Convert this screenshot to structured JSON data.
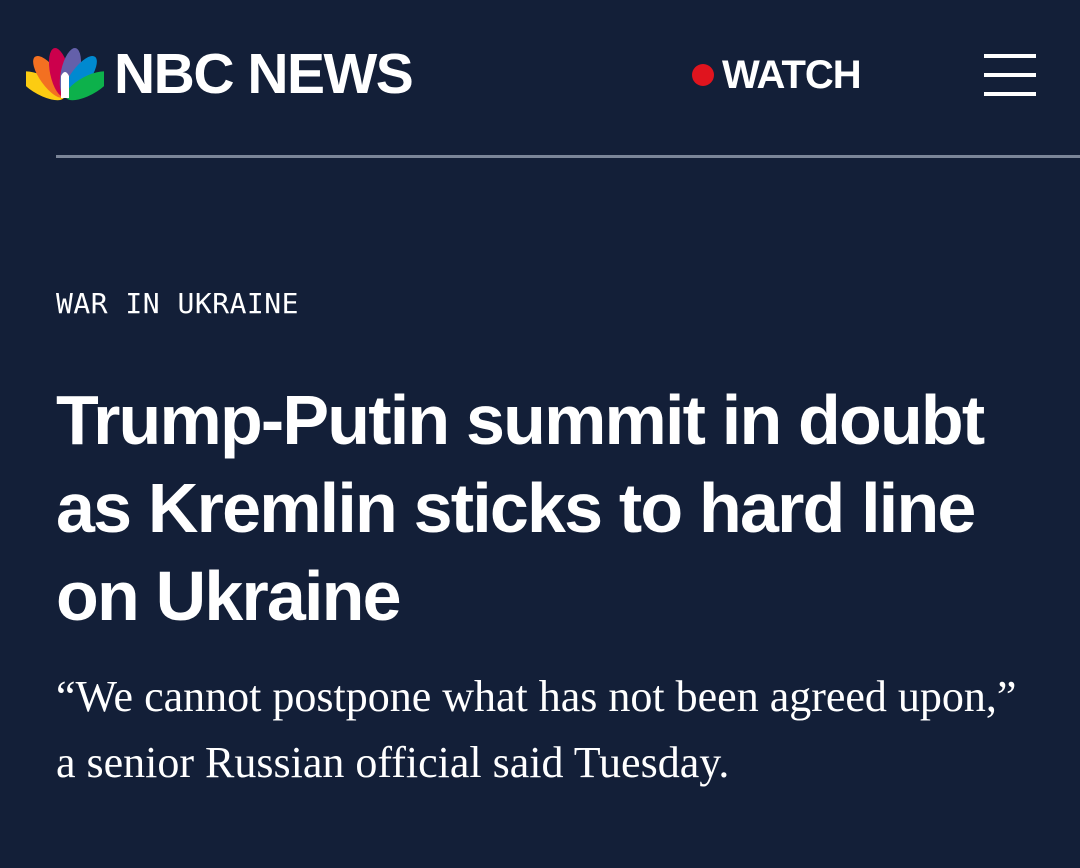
{
  "header": {
    "brand_name": "NBC NEWS",
    "logo_icon": "nbc-peacock-icon",
    "watch_label": "WATCH",
    "watch_icon": "live-dot-icon",
    "menu_icon": "hamburger-menu-icon"
  },
  "article": {
    "eyebrow": "WAR IN UKRAINE",
    "headline": "Trump-Putin summit in doubt as Kremlin sticks to hard line on Ukraine",
    "dek": "“We cannot postpone what has not been agreed upon,” a senior Russian official said Tuesday."
  },
  "colors": {
    "background": "#131f38",
    "text": "#ffffff",
    "live_red": "#e0141e",
    "divider": "#7b8598",
    "peacock": [
      "#fccc12",
      "#f37021",
      "#cc004c",
      "#6460aa",
      "#0089d0",
      "#0db14b"
    ]
  }
}
